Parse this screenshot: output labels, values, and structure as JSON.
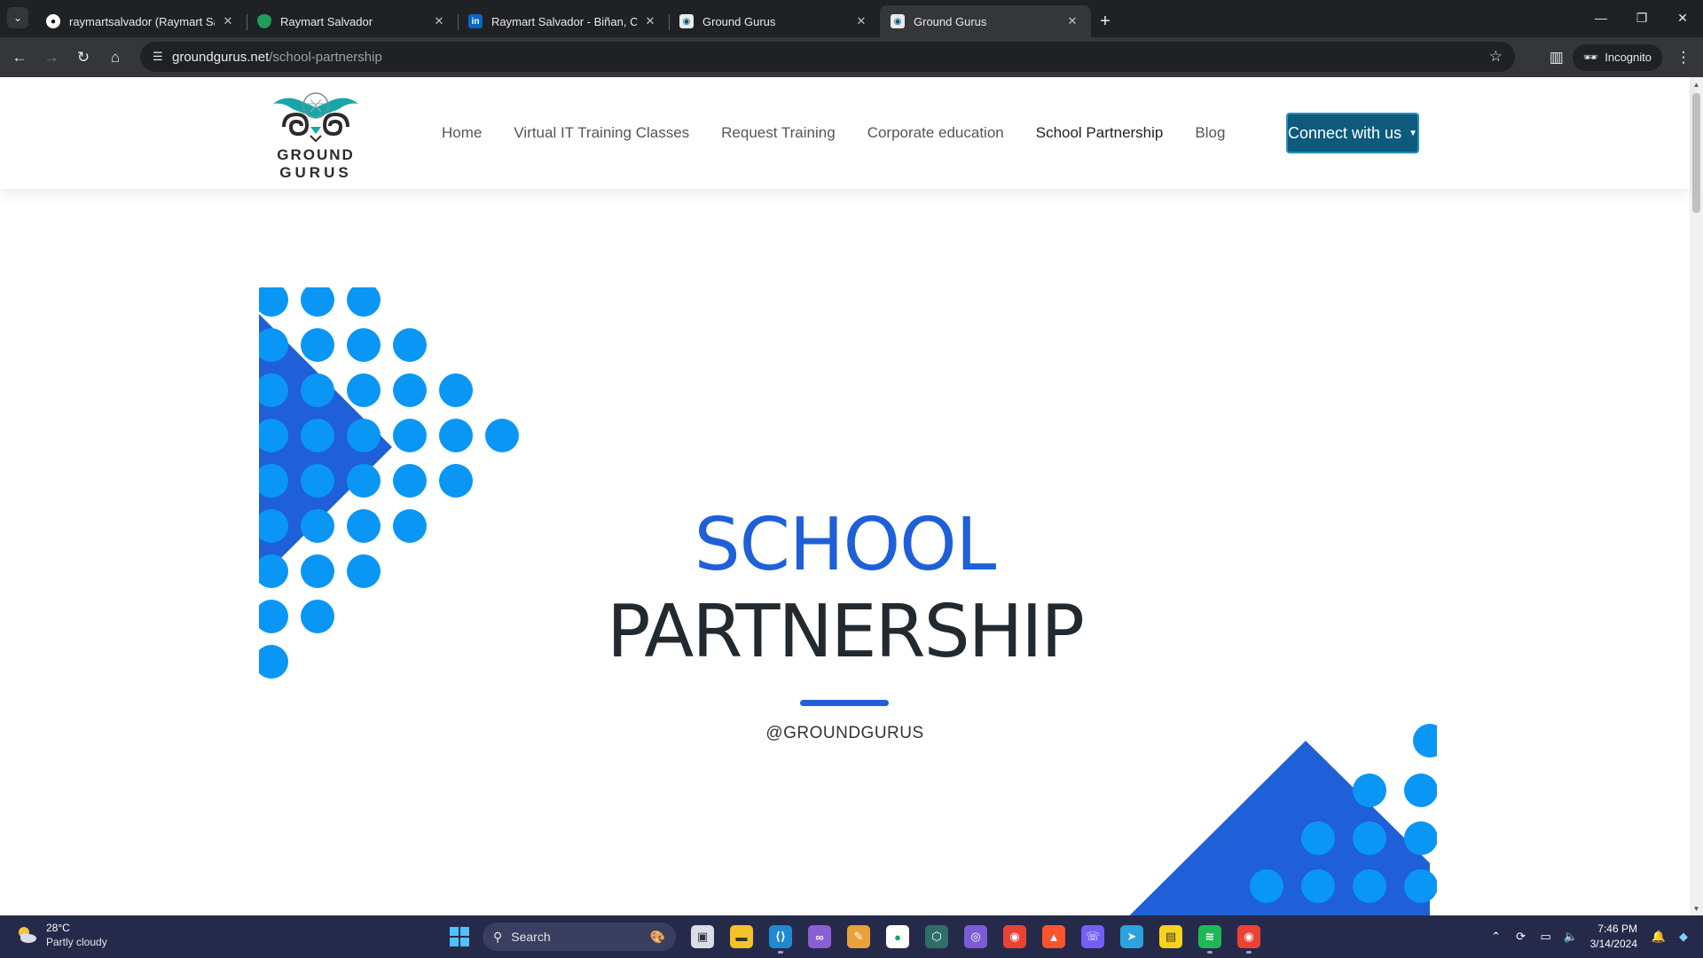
{
  "browser": {
    "tabs": [
      {
        "title": "raymartsalvador (Raymart Salvador)",
        "favicon": "github-icon",
        "active": false
      },
      {
        "title": "Raymart Salvador",
        "favicon": "shield-leaf-icon",
        "active": false
      },
      {
        "title": "Raymart Salvador - Biñan, Calabarzon",
        "favicon": "linkedin-icon",
        "active": false
      },
      {
        "title": "Ground Gurus",
        "favicon": "groundgurus-icon",
        "active": false
      },
      {
        "title": "Ground Gurus",
        "favicon": "groundgurus-icon",
        "active": true
      }
    ],
    "url_host": "groundgurus.net",
    "url_path": "/school-partnership",
    "incognito_label": "Incognito"
  },
  "site": {
    "logo_top": "GROUND",
    "logo_bottom": "GURUS",
    "nav": [
      {
        "label": "Home",
        "current": false
      },
      {
        "label": "Virtual IT Training Classes",
        "current": false
      },
      {
        "label": "Request Training",
        "current": false
      },
      {
        "label": "Corporate education",
        "current": false
      },
      {
        "label": "School Partnership",
        "current": true
      },
      {
        "label": "Blog",
        "current": false
      }
    ],
    "connect_label": "Connect with us"
  },
  "hero": {
    "title_line1": "SCHOOL",
    "title_line2": "PARTNERSHIP",
    "handle": "@GROUNDGURUS"
  },
  "colors": {
    "accent_blue": "#1f60d8",
    "dot_blue": "#0a96f5",
    "button_teal": "#0d5a7d",
    "taskbar": "#262a4a"
  },
  "taskbar": {
    "weather_temp": "28°C",
    "weather_condition": "Partly cloudy",
    "search_placeholder": "Search",
    "apps": [
      "task-view-icon",
      "file-explorer-icon",
      "vscode-icon",
      "visual-studio-icon",
      "paint-icon",
      "mongodb-compass-icon",
      "app-icon",
      "github-desktop-icon",
      "chrome-icon",
      "brave-icon",
      "viber-icon",
      "telegram-icon",
      "sticky-notes-icon",
      "spotify-icon",
      "chrome-incognito-icon"
    ],
    "time": "7:46 PM",
    "date": "3/14/2024"
  }
}
